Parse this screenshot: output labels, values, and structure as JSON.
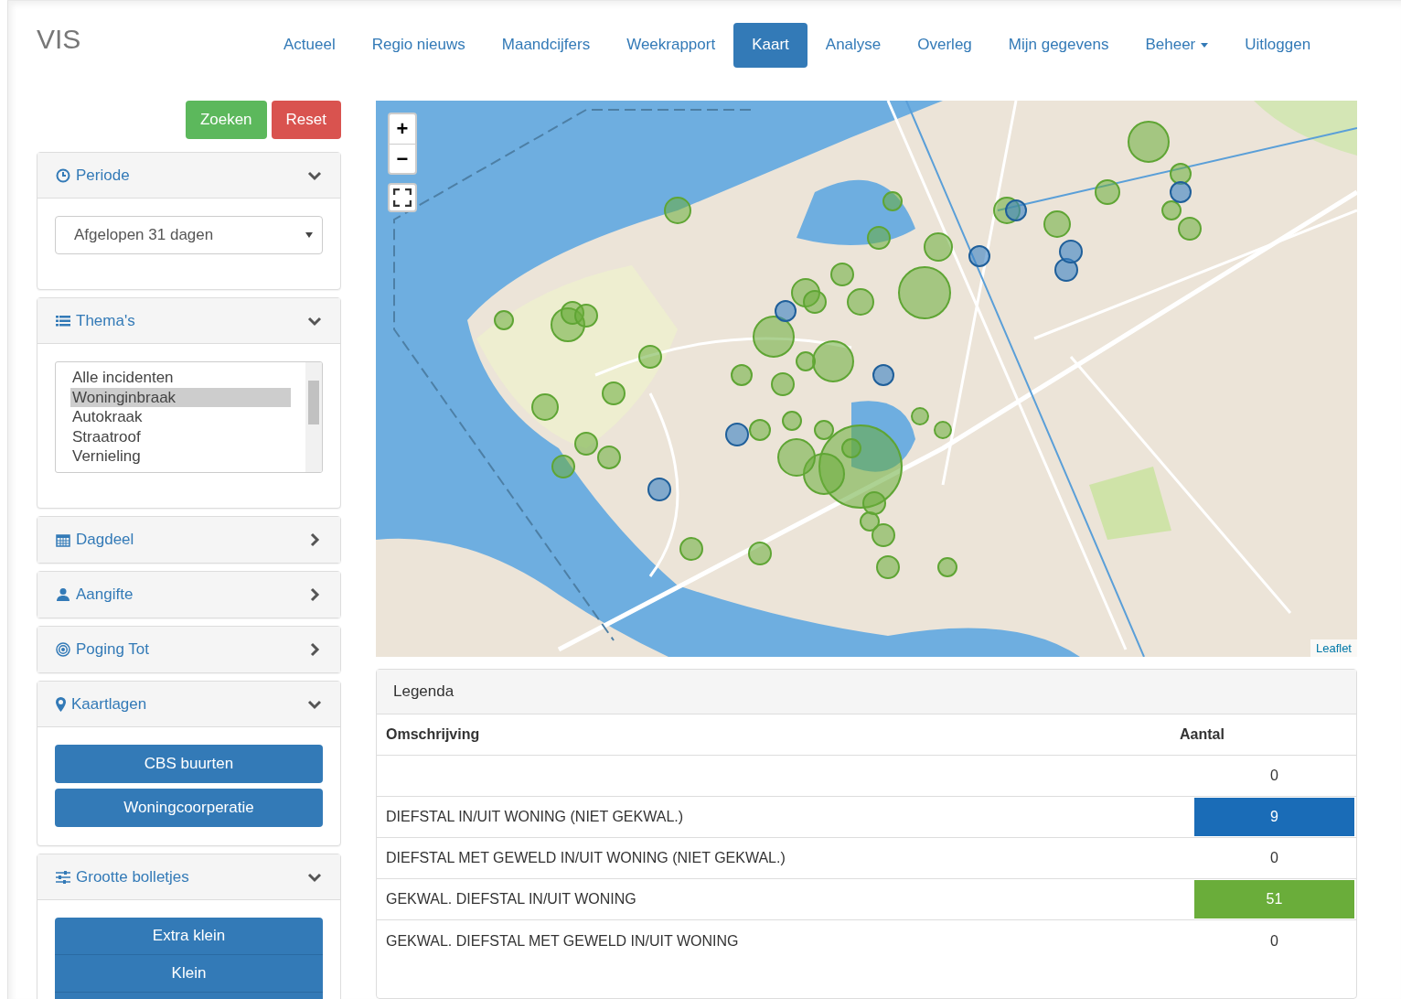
{
  "brand": "VIS",
  "nav": [
    {
      "label": "Actueel",
      "selected": false,
      "dropdown": false
    },
    {
      "label": "Regio nieuws",
      "selected": false,
      "dropdown": false
    },
    {
      "label": "Maandcijfers",
      "selected": false,
      "dropdown": false
    },
    {
      "label": "Weekrapport",
      "selected": false,
      "dropdown": false
    },
    {
      "label": "Kaart",
      "selected": true,
      "dropdown": false
    },
    {
      "label": "Analyse",
      "selected": false,
      "dropdown": false
    },
    {
      "label": "Overleg",
      "selected": false,
      "dropdown": false
    },
    {
      "label": "Mijn gegevens",
      "selected": false,
      "dropdown": false
    },
    {
      "label": "Beheer",
      "selected": false,
      "dropdown": true
    },
    {
      "label": "Uitloggen",
      "selected": false,
      "dropdown": false
    }
  ],
  "actions": [
    {
      "label": "Zoeken",
      "kind": "success"
    },
    {
      "label": "Reset",
      "kind": "danger"
    }
  ],
  "panels": [
    {
      "title": "Periode",
      "expanded": true,
      "kind": "select",
      "value": "Afgelopen 31 dagen"
    },
    {
      "title": "Thema's",
      "expanded": true,
      "kind": "listbox",
      "options": [
        {
          "label": "Alle incidenten",
          "selected": false
        },
        {
          "label": "Woninginbraak",
          "selected": true
        },
        {
          "label": "Autokraak",
          "selected": false
        },
        {
          "label": "Straatroof",
          "selected": false
        },
        {
          "label": "Vernieling",
          "selected": false
        }
      ]
    },
    {
      "title": "Dagdeel",
      "expanded": false
    },
    {
      "title": "Aangifte",
      "expanded": false
    },
    {
      "title": "Poging Tot",
      "expanded": false
    },
    {
      "title": "Kaartlagen",
      "expanded": true,
      "kind": "buttons",
      "buttons": [
        "CBS buurten",
        "Woningcoorperatie"
      ]
    },
    {
      "title": "Grootte bolletjes",
      "expanded": true,
      "kind": "group",
      "buttons": [
        "Extra klein",
        "Klein"
      ]
    }
  ],
  "map": {
    "zoom_in": "+",
    "zoom_out": "−",
    "attribution": "Leaflet"
  },
  "legend": {
    "title": "Legenda",
    "columns": [
      "Omschrijving",
      "Aantal"
    ],
    "rows": [
      {
        "count": "0"
      },
      {
        "description": "DIEFSTAL IN/UIT WONING (NIET GEKWAL.)",
        "count": "9",
        "color": "#1a6cb7"
      },
      {
        "description": "DIEFSTAL MET GEWELD IN/UIT WONING (NIET GEKWAL.)",
        "count": "0"
      },
      {
        "description": "GEKWAL. DIEFSTAL IN/UIT WONING",
        "count": "51",
        "color": "#6aad3a"
      },
      {
        "description": "GEKWAL. DIEFSTAL MET GEWELD IN/UIT WONING",
        "count": "0"
      }
    ]
  }
}
